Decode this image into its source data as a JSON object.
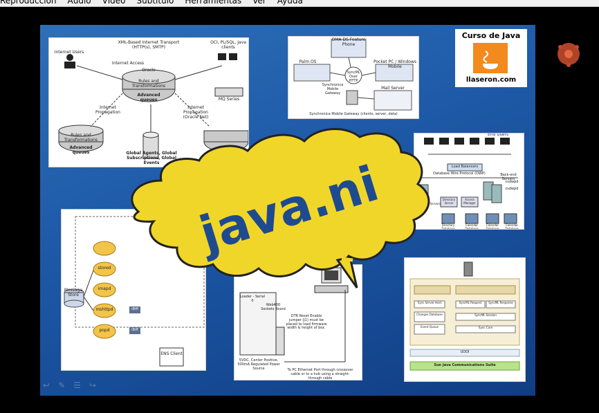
{
  "menubar": {
    "items": [
      "Reproducción",
      "Audio",
      "Vídeo",
      "Subtítulo",
      "Herramientas",
      "Ver",
      "Ayuda"
    ]
  },
  "slide": {
    "bubble_text": "java.ni",
    "course_logo": {
      "line1": "Curso de Java",
      "line2": "llaseron.com"
    },
    "diagram_oracle": {
      "header_left": "Internet Users",
      "header_center": "XML-Based Internet Transport (HTTP(s), SMTP)",
      "header_right": "OCI, PL/SQL, Java clients",
      "internet_access": "Internet Access",
      "oracle": "Oracle",
      "rules1": "Rules and Transformations",
      "advanced1": "Advanced queues",
      "mq": "MQ Series",
      "prop_left": "Internet Propagation",
      "prop_right": "Internet Propagation (Oracle Net)",
      "rules2": "Rules and Transformations",
      "advanced2": "Advanced queues",
      "global": "Global Agents, Global Subscriptions, Global Events"
    },
    "diagram_sync": {
      "top": "OMA DS Feature Phone",
      "palm": "Palm OS",
      "pocket": "Pocket PC / Windows Mobile",
      "syncml": "SyncML Over HTTP",
      "gateway": "Synchronica Mobile Gateway",
      "mail": "Mail Server",
      "caption": "Synchronica Mobile Gateway (clients, server, data)"
    },
    "diagram_lb": {
      "end_users": "End Users",
      "lb": "Load Balancers",
      "protocol": "Database Wire Protocol (DWP)",
      "backend": "Back-end Servers",
      "dir": "Directory Server",
      "access": "Access Manager",
      "dbs": [
        "Directory Database",
        "Calendar Database",
        "Calendar Database",
        "Calendar Database"
      ],
      "nodes": [
        "csdwpd",
        "csdwpd"
      ],
      "frontend": "Front-end Servers"
    },
    "diagram_ms": {
      "store": "Message Store",
      "procs": [
        "stored",
        "imapd",
        "mshttpd",
        "popd"
      ],
      "tags": [
        "iBiff",
        "iBiff"
      ],
      "ens": "ENS Client"
    },
    "diagram_hw": {
      "serial": "Loader - Serial 0",
      "wsb": "Web400 Sockets Board",
      "dtr": "DTR Reset Enable jumper (J1) must be placed to load firmware width & height of box.",
      "psu": "5VDC, Center Positive, 300mA Regulated Power Source",
      "eth": "To PC Ethernet Port through crossover cable or to a hub using a straight-through cable"
    },
    "diagram_suite": {
      "title": "Sun Java Communications Suite",
      "uddi": "UDDI",
      "blocks": [
        "Sync Server Host",
        "SyncML Request",
        "SyncML Response",
        "Changes Database",
        "SyncML Session",
        "Event Queue",
        "Sync Core"
      ]
    }
  },
  "colors": {
    "slide_bg": "#1e5aa8",
    "bubble": "#f1d62a",
    "bubble_text": "#1e4b8f"
  }
}
